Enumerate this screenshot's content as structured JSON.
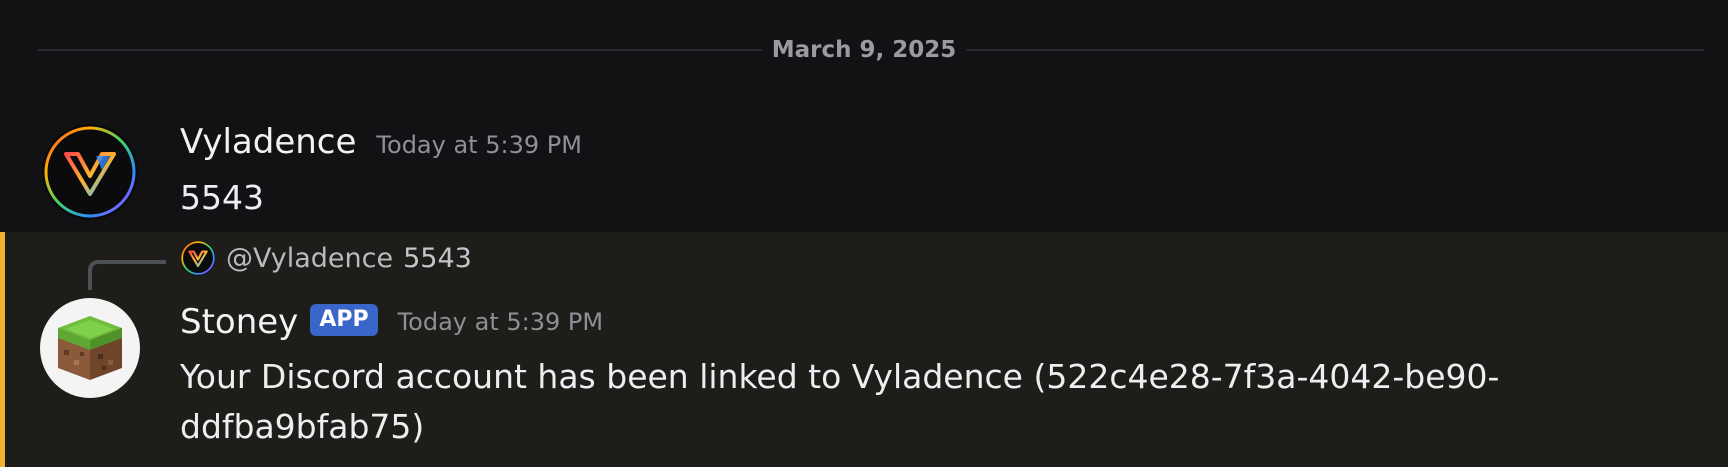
{
  "divider": {
    "date": "March 9, 2025"
  },
  "messages": [
    {
      "author": "Vyladence",
      "avatar_icon": "vyladence-logo-icon",
      "timestamp": "Today at 5:39 PM",
      "content": "5543"
    },
    {
      "reply_to": {
        "author": "@Vyladence",
        "content": "5543"
      },
      "author": "Stoney",
      "badge": "APP",
      "avatar_icon": "grass-block-icon",
      "timestamp": "Today at 5:39 PM",
      "content": "Your Discord account has been linked to Vyladence (522c4e28-7f3a-4042-be90-ddfba9bfab75)",
      "highlighted": true
    }
  ],
  "colors": {
    "background": "#121214",
    "mention_highlight_bg": "#1e1d19",
    "mention_bar": "#f0b232",
    "app_badge": "#3b66c9",
    "timestamp": "#8e9097"
  }
}
